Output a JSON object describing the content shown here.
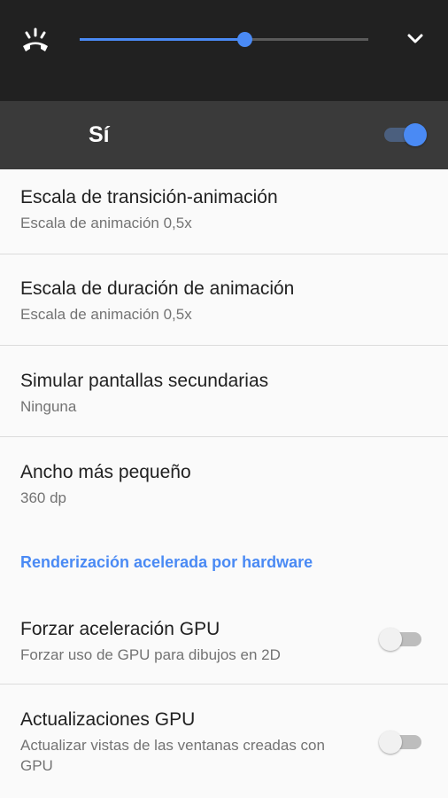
{
  "volume": {
    "icon": "phone-ring-icon",
    "level": 0.57,
    "expand_icon": "chevron-down-icon",
    "accent": "#4a8af4"
  },
  "master": {
    "label": "Sí",
    "enabled": true
  },
  "settings": [
    {
      "title": "Escala de transición-animación",
      "summary": "Escala de animación 0,5x"
    },
    {
      "title": "Escala de duración de animación",
      "summary": "Escala de animación 0,5x"
    },
    {
      "title": "Simular pantallas secundarias",
      "summary": "Ninguna"
    },
    {
      "title": "Ancho más pequeño",
      "summary": "360 dp"
    }
  ],
  "hardware_category": "Renderización acelerada por hardware",
  "hardware_settings": [
    {
      "title": "Forzar aceleración GPU",
      "summary": "Forzar uso de GPU para dibujos en 2D",
      "enabled": false
    },
    {
      "title": "Actualizaciones GPU",
      "summary": "Actualizar vistas de las ventanas creadas con GPU",
      "enabled": false
    }
  ]
}
